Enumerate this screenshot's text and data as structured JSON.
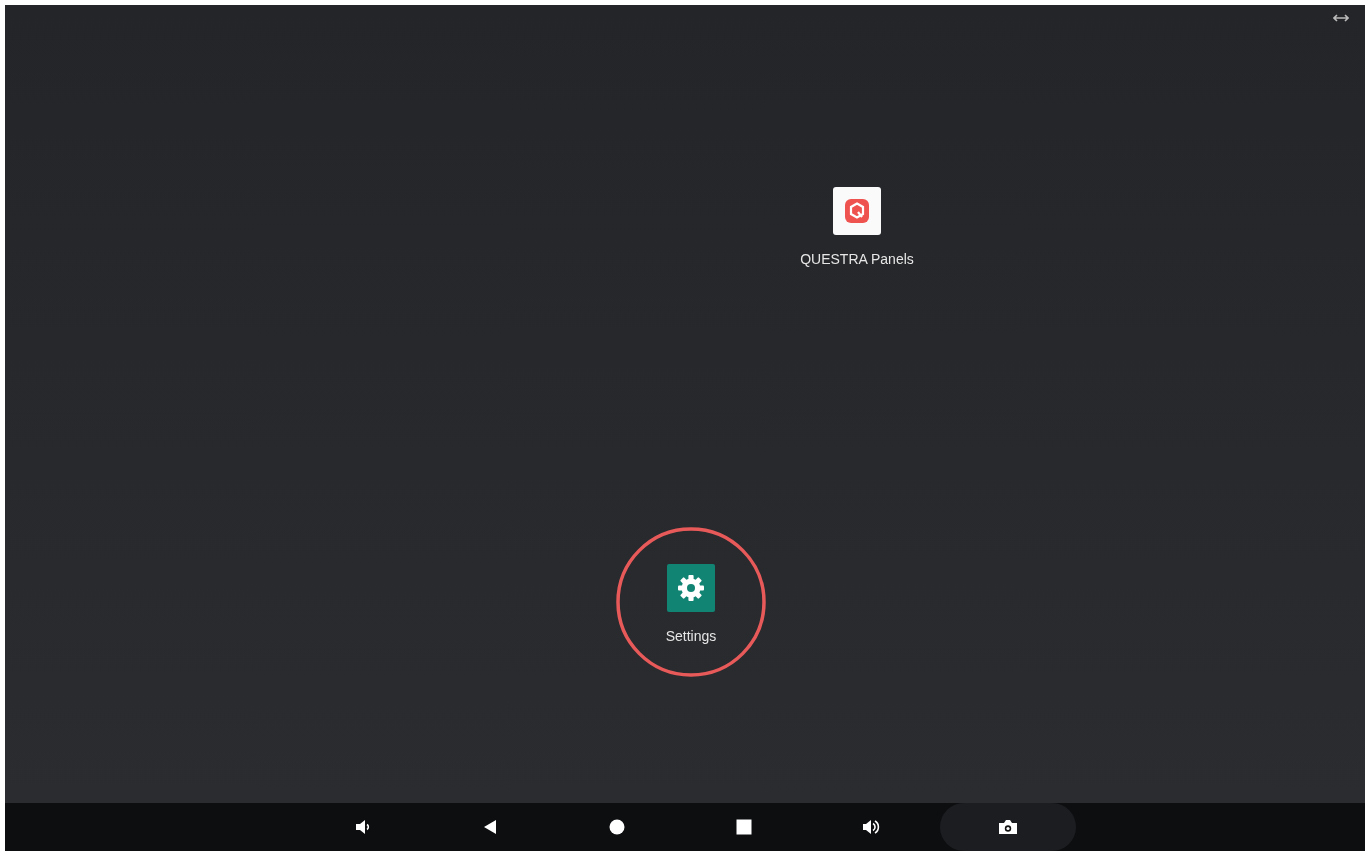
{
  "home_screen": {
    "apps": [
      {
        "label": "QUESTRA Panels",
        "kind": "questra",
        "highlighted": false
      },
      {
        "label": "Settings",
        "kind": "settings",
        "highlighted": true
      }
    ]
  },
  "navigation_bar": {
    "buttons": [
      {
        "kind": "volume-down"
      },
      {
        "kind": "back"
      },
      {
        "kind": "home"
      },
      {
        "kind": "recents"
      },
      {
        "kind": "volume-up"
      },
      {
        "kind": "screenshot"
      }
    ]
  }
}
